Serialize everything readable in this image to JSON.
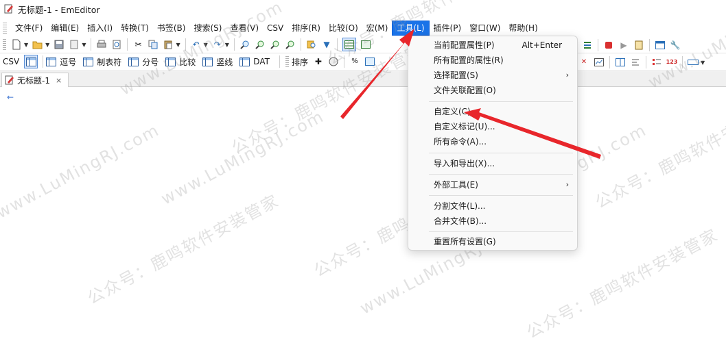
{
  "window": {
    "title": "无标题-1 - EmEditor"
  },
  "menubar": {
    "items": [
      "文件(F)",
      "编辑(E)",
      "插入(I)",
      "转换(T)",
      "书签(B)",
      "搜索(S)",
      "查看(V)",
      "CSV",
      "排序(R)",
      "比较(O)",
      "宏(M)",
      "工具(L)",
      "插件(P)",
      "窗口(W)",
      "帮助(H)"
    ],
    "active": "工具(L)"
  },
  "csv_toolbar": {
    "label": "CSV",
    "buttons": [
      "逗号",
      "制表符",
      "分号",
      "比较",
      "竖线",
      "DAT"
    ],
    "sort_label": "排序"
  },
  "tab": {
    "label": "无标题-1",
    "close": "×"
  },
  "tools_menu": {
    "items": [
      {
        "label": "当前配置属性(P)",
        "shortcut": "Alt+Enter"
      },
      {
        "label": "所有配置的属性(R)"
      },
      {
        "label": "选择配置(S)",
        "submenu": "›"
      },
      {
        "label": "文件关联配置(O)"
      },
      {
        "label": "自定义(C)..."
      },
      {
        "label": "自定义标记(U)..."
      },
      {
        "label": "所有命令(A)..."
      },
      {
        "label": "导入和导出(X)..."
      },
      {
        "label": "外部工具(E)",
        "submenu": "›"
      },
      {
        "label": "分割文件(L)..."
      },
      {
        "label": "合并文件(B)..."
      },
      {
        "label": "重置所有设置(G)"
      }
    ]
  },
  "watermark": {
    "brand": "公众号：鹿鸣软件安装管家",
    "site": "www.LuMingRJ.com"
  },
  "colors": {
    "accent": "#1a73e8",
    "arrow": "#e8262b",
    "caret": "#3b73d1"
  },
  "icons": {
    "toolbar1": [
      "new-file-icon",
      "open-folder-icon",
      "save-icon",
      "save-as-icon",
      "print-icon",
      "print-preview-icon",
      "cut-icon",
      "copy-icon",
      "paste-icon",
      "undo-icon",
      "redo-icon",
      "find-icon",
      "find-next-icon",
      "find-prev-icon",
      "replace-icon",
      "filter-icon",
      "csv-mode-icon"
    ],
    "tail": [
      "stop-record-icon",
      "macro-run-icon",
      "macro-edit-icon",
      "window-icon",
      "wrench-icon"
    ]
  }
}
